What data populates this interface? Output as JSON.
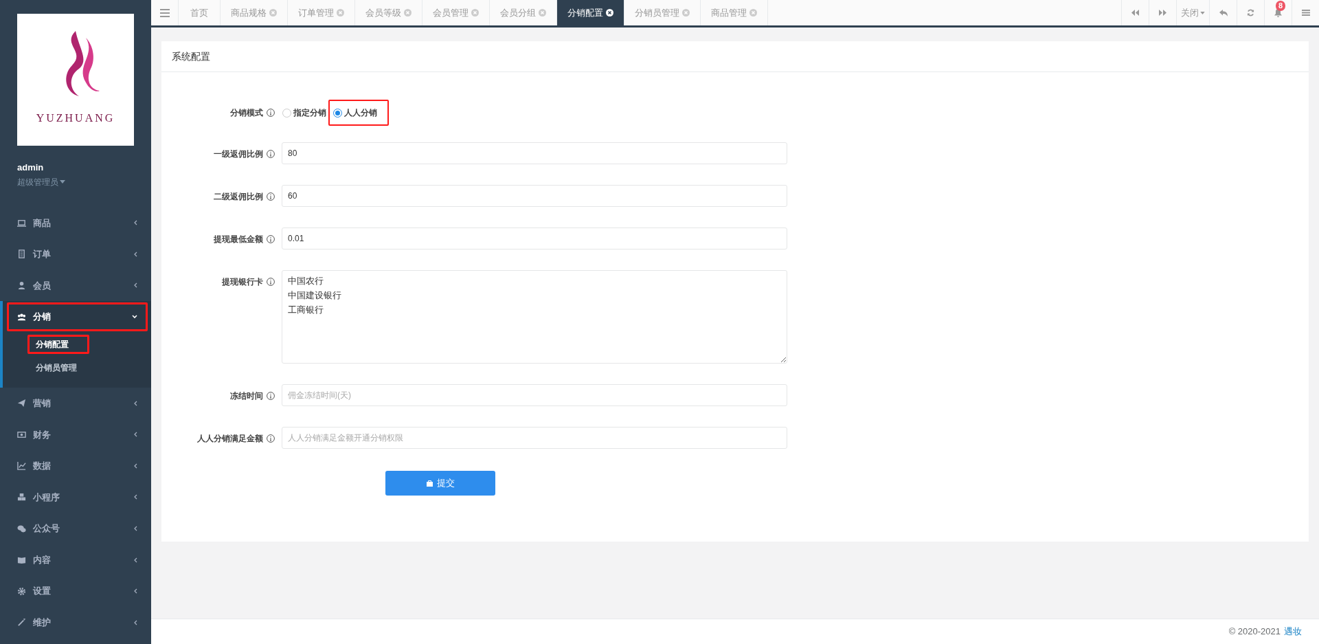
{
  "sidebar": {
    "logo_text": "YUZHUANG",
    "user": {
      "name": "admin",
      "role": "超级管理员"
    },
    "menu": [
      {
        "label": "商品",
        "expanded": false,
        "highlighted": false
      },
      {
        "label": "订单",
        "expanded": false,
        "highlighted": false
      },
      {
        "label": "会员",
        "expanded": false,
        "highlighted": false
      },
      {
        "label": "分销",
        "expanded": true,
        "highlighted": true,
        "children": [
          {
            "label": "分销配置",
            "selected": true,
            "highlighted": true
          },
          {
            "label": "分销员管理",
            "selected": false,
            "highlighted": false
          }
        ]
      },
      {
        "label": "营销",
        "expanded": false,
        "highlighted": false
      },
      {
        "label": "财务",
        "expanded": false,
        "highlighted": false
      },
      {
        "label": "数据",
        "expanded": false,
        "highlighted": false
      },
      {
        "label": "小程序",
        "expanded": false,
        "highlighted": false
      },
      {
        "label": "公众号",
        "expanded": false,
        "highlighted": false
      },
      {
        "label": "内容",
        "expanded": false,
        "highlighted": false
      },
      {
        "label": "设置",
        "expanded": false,
        "highlighted": false
      },
      {
        "label": "维护",
        "expanded": false,
        "highlighted": false
      }
    ]
  },
  "tabs": [
    {
      "label": "首页",
      "selected": false,
      "closable": false
    },
    {
      "label": "商品规格",
      "selected": false,
      "closable": true
    },
    {
      "label": "订单管理",
      "selected": false,
      "closable": true
    },
    {
      "label": "会员等级",
      "selected": false,
      "closable": true
    },
    {
      "label": "会员管理",
      "selected": false,
      "closable": true
    },
    {
      "label": "会员分组",
      "selected": false,
      "closable": true
    },
    {
      "label": "分销配置",
      "selected": true,
      "closable": true
    },
    {
      "label": "分销员管理",
      "selected": false,
      "closable": true
    },
    {
      "label": "商品管理",
      "selected": false,
      "closable": true
    }
  ],
  "toolbar": {
    "close_label": "关闭",
    "notification_count": "8"
  },
  "card": {
    "title": "系统配置",
    "fields": [
      {
        "kind": "radio",
        "label": "分销模式",
        "options": [
          {
            "label": "指定分销",
            "selected": false,
            "highlighted": false
          },
          {
            "label": "人人分销",
            "selected": true,
            "highlighted": true
          }
        ]
      },
      {
        "kind": "input",
        "label": "一级返佣比例",
        "value": "80"
      },
      {
        "kind": "input",
        "label": "二级返佣比例",
        "value": "60"
      },
      {
        "kind": "input",
        "label": "提现最低金额",
        "value": "0.01"
      },
      {
        "kind": "textarea",
        "label": "提现银行卡",
        "lines": [
          "中国农行",
          "中国建设银行",
          "工商银行"
        ]
      },
      {
        "kind": "input",
        "label": "冻结时间",
        "placeholder": "佣金冻结时间(天)"
      },
      {
        "kind": "input",
        "label": "人人分销满足金额",
        "placeholder": "人人分销满足金额开通分销权限"
      }
    ],
    "submit": "提交"
  },
  "footer": {
    "copyright": "© 2020-2021",
    "link": "遇妆"
  }
}
